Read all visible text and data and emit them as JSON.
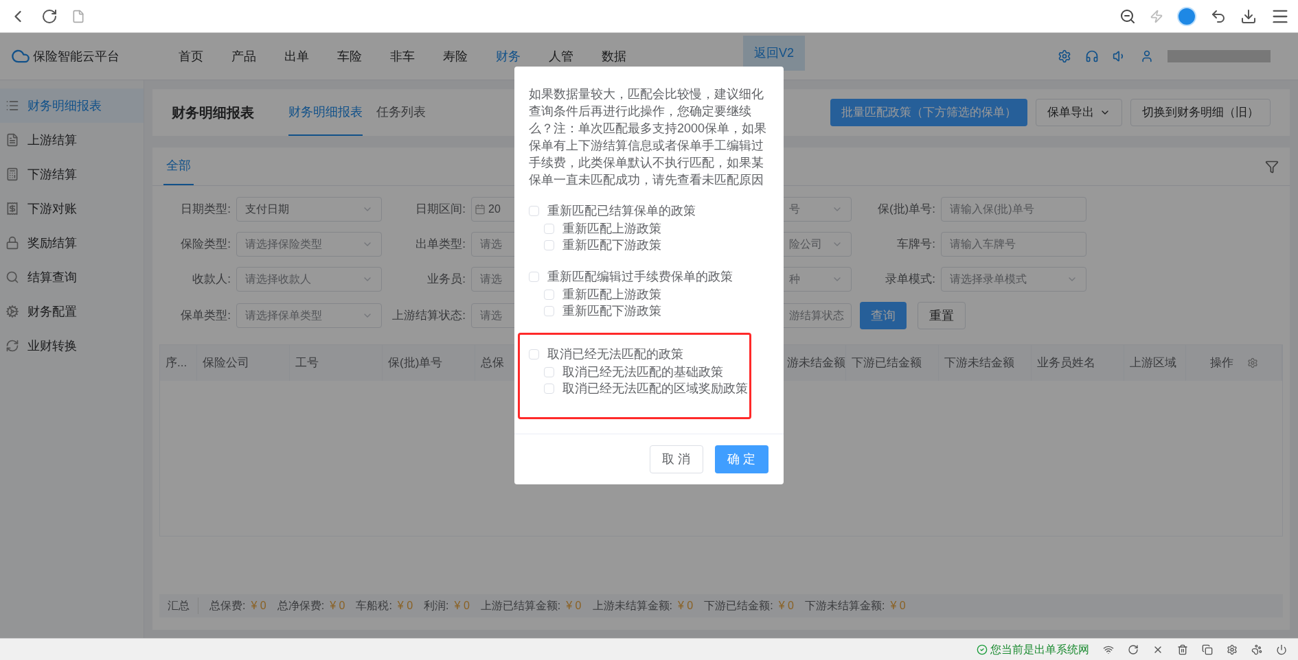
{
  "header": {
    "brand": "保险智能云平台",
    "nav": [
      {
        "label": "首页",
        "selected": false
      },
      {
        "label": "产品",
        "selected": false
      },
      {
        "label": "出单",
        "selected": false
      },
      {
        "label": "车险",
        "selected": false
      },
      {
        "label": "非车",
        "selected": false
      },
      {
        "label": "寿险",
        "selected": false
      },
      {
        "label": "财务",
        "selected": true
      },
      {
        "label": "人管",
        "selected": false
      },
      {
        "label": "数据",
        "selected": false
      }
    ],
    "back_tag": "返回V2"
  },
  "sidebar": {
    "items": [
      {
        "label": "财务明细报表",
        "selected": true
      },
      {
        "label": "上游结算",
        "selected": false
      },
      {
        "label": "下游结算",
        "selected": false
      },
      {
        "label": "下游对账",
        "selected": false
      },
      {
        "label": "奖励结算",
        "selected": false
      },
      {
        "label": "结算查询",
        "selected": false
      },
      {
        "label": "财务配置",
        "selected": false
      },
      {
        "label": "业财转换",
        "selected": false
      }
    ]
  },
  "page": {
    "title": "财务明细报表",
    "tabs": [
      {
        "label": "财务明细报表",
        "selected": true
      },
      {
        "label": "任务列表",
        "selected": false
      }
    ],
    "batch_button": "批量匹配政策（下方筛选的保单）",
    "export_button": "保单导出",
    "switch_button": "切换到财务明细（旧）"
  },
  "filter": {
    "tabs": [
      {
        "label": "全部",
        "selected": true
      }
    ],
    "rows": [
      [
        {
          "label": "日期类型:",
          "kind": "select",
          "value": "支付日期"
        },
        {
          "label": "日期区间:",
          "kind": "date",
          "value": "20"
        },
        {
          "kind": "select",
          "placeholder": "号"
        },
        {
          "label": "保(批)单号:",
          "kind": "input",
          "placeholder": "请输入保(批)单号"
        }
      ],
      [
        {
          "label": "保险类型:",
          "kind": "select",
          "placeholder": "请选择保险类型"
        },
        {
          "label": "出单类型:",
          "kind": "input",
          "placeholder": "请选"
        },
        {
          "kind": "select",
          "placeholder": "险公司"
        },
        {
          "label": "车牌号:",
          "kind": "input",
          "placeholder": "请输入车牌号"
        }
      ],
      [
        {
          "label": "收款人:",
          "kind": "select",
          "placeholder": "请选择收款人"
        },
        {
          "label": "业务员:",
          "kind": "input",
          "placeholder": "请选"
        },
        {
          "kind": "select",
          "placeholder": "种"
        },
        {
          "label": "录单模式:",
          "kind": "select",
          "placeholder": "请选择录单模式"
        }
      ],
      [
        {
          "label": "保单类型:",
          "kind": "select",
          "placeholder": "请选择保单类型"
        },
        {
          "label": "上游结算状态:",
          "kind": "input",
          "placeholder": "请选"
        },
        {
          "kind": "select",
          "placeholder": "游结算状态"
        }
      ]
    ],
    "query_button": "查询",
    "reset_button": "重置"
  },
  "table": {
    "columns": [
      "序...",
      "保险公司",
      "工号",
      "保(批)单号",
      "总保",
      "游未结金额",
      "下游已结金额",
      "下游未结金额",
      "业务员姓名",
      "上游区域",
      "操作"
    ]
  },
  "summary": {
    "label": "汇总",
    "items": [
      {
        "label": "总保费:",
        "value": "¥ 0"
      },
      {
        "label": "总净保费:",
        "value": "¥ 0"
      },
      {
        "label": "车船税:",
        "value": "¥ 0"
      },
      {
        "label": "利润:",
        "value": "¥ 0"
      },
      {
        "label": "上游已结算金额:",
        "value": "¥ 0"
      },
      {
        "label": "上游未结算金额:",
        "value": "¥ 0"
      },
      {
        "label": "下游已结金额:",
        "value": "¥ 0"
      },
      {
        "label": "下游未结算金额:",
        "value": "¥ 0"
      }
    ]
  },
  "dialog": {
    "message": "如果数据量较大，匹配会比较慢，建议细化查询条件后再进行此操作，您确定要继续么？注：单次匹配最多支持2000保单，如果保单有上下游结算信息或者保单手工编辑过手续费，此类保单默认不执行匹配，如果某保单一直未匹配成功，请先查看未匹配原因",
    "groups": [
      {
        "label": "重新匹配已结算保单的政策",
        "checked": false,
        "highlighted": false,
        "children": [
          {
            "label": "重新匹配上游政策",
            "checked": false
          },
          {
            "label": "重新匹配下游政策",
            "checked": false
          }
        ]
      },
      {
        "label": "重新匹配编辑过手续费保单的政策",
        "checked": false,
        "highlighted": false,
        "children": [
          {
            "label": "重新匹配上游政策",
            "checked": false
          },
          {
            "label": "重新匹配下游政策",
            "checked": false
          }
        ]
      },
      {
        "label": "取消已经无法匹配的政策",
        "checked": false,
        "highlighted": true,
        "children": [
          {
            "label": "取消已经无法匹配的基础政策",
            "checked": false
          },
          {
            "label": "取消已经无法匹配的区域奖励政策",
            "checked": false
          }
        ]
      }
    ],
    "cancel_button": "取 消",
    "confirm_button": "确 定"
  },
  "status_bar": {
    "message": "您当前是出单系统网"
  }
}
